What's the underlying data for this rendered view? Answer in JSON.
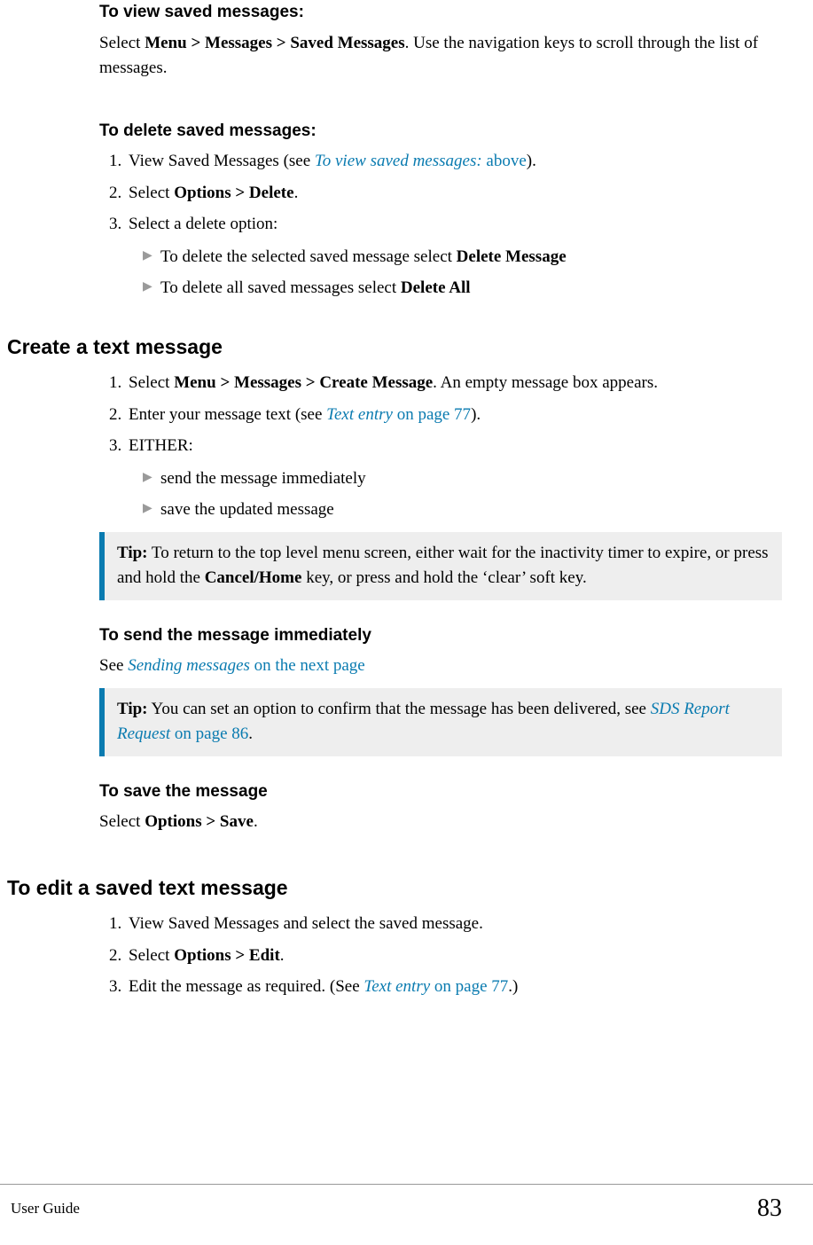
{
  "view_saved": {
    "heading": "To view saved messages:",
    "para_prefix": "Select ",
    "path_bold": "Menu > Messages > Saved Messages",
    "para_suffix": ". Use the navigation keys to scroll through the list of messages."
  },
  "delete_saved": {
    "heading": "To delete saved messages:",
    "step1_prefix": "View Saved Messages (see ",
    "step1_link": "To view saved messages:",
    "step1_link_suffix": " above",
    "step1_suffix": ").",
    "step2_prefix": "Select ",
    "step2_bold": "Options > Delete",
    "step2_suffix": ".",
    "step3": "Select a delete option:",
    "sub1_prefix": "To delete the selected saved message select ",
    "sub1_bold": "Delete Message",
    "sub2_prefix": "To delete all saved messages select ",
    "sub2_bold": "Delete All"
  },
  "create": {
    "heading": "Create a text message",
    "step1_prefix": "Select ",
    "step1_bold": "Menu > Messages > Create Message",
    "step1_suffix": ". An empty message box appears.",
    "step2_prefix": "Enter your message text (see ",
    "step2_link": "Text entry",
    "step2_link_suffix": " on page 77",
    "step2_suffix": ").",
    "step3": "EITHER:",
    "sub1": "send the message immediately",
    "sub2": "save the updated message",
    "tip1_label": "Tip:",
    "tip1_text_a": "  To return to the top level menu screen, either wait for the inactivity timer to expire, or press and hold the ",
    "tip1_bold": "Cancel/Home",
    "tip1_text_b": " key, or press and hold the ‘clear’ soft key."
  },
  "send_immediately": {
    "heading": "To send the message immediately",
    "para_prefix": "See ",
    "link": "Sending messages",
    "link_suffix": " on the next page",
    "tip_label": "Tip:",
    "tip_text_a": "  You can set an option to confirm that the message has been delivered, see ",
    "tip_link": "SDS Report Request",
    "tip_link_suffix": " on page 86",
    "tip_text_b": "."
  },
  "save_msg": {
    "heading": "To save the message",
    "para_prefix": "Select ",
    "bold": "Options > Save",
    "suffix": "."
  },
  "edit_saved": {
    "heading": "To edit a saved text message",
    "step1": "View Saved Messages and select the saved message.",
    "step2_prefix": "Select ",
    "step2_bold": "Options > Edit",
    "step2_suffix": ".",
    "step3_prefix": "Edit the message as required. (See ",
    "step3_link": "Text entry",
    "step3_link_suffix": " on page 77",
    "step3_suffix": ".)"
  },
  "footer": {
    "left": "User Guide",
    "right": "83"
  },
  "glyph": {
    "tri": "▶"
  }
}
